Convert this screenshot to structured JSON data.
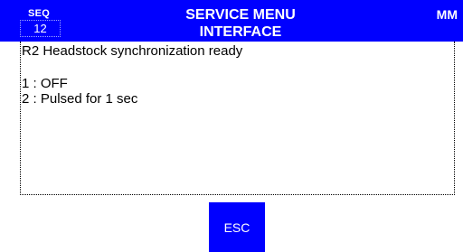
{
  "header": {
    "seq_label": "SEQ",
    "seq_value": "12",
    "title": "SERVICE MENU",
    "subtitle": "INTERFACE",
    "mode": "MM"
  },
  "content": {
    "message": "R2 Headstock synchronization ready",
    "options": [
      "1 : OFF",
      "2 : Pulsed for 1 sec"
    ]
  },
  "actions": {
    "esc_label": "ESC"
  },
  "colors": {
    "header_bg": "#0000ff",
    "button_bg": "#0000ff",
    "text_on_blue": "#ffffff",
    "body_bg": "#ffffff"
  }
}
